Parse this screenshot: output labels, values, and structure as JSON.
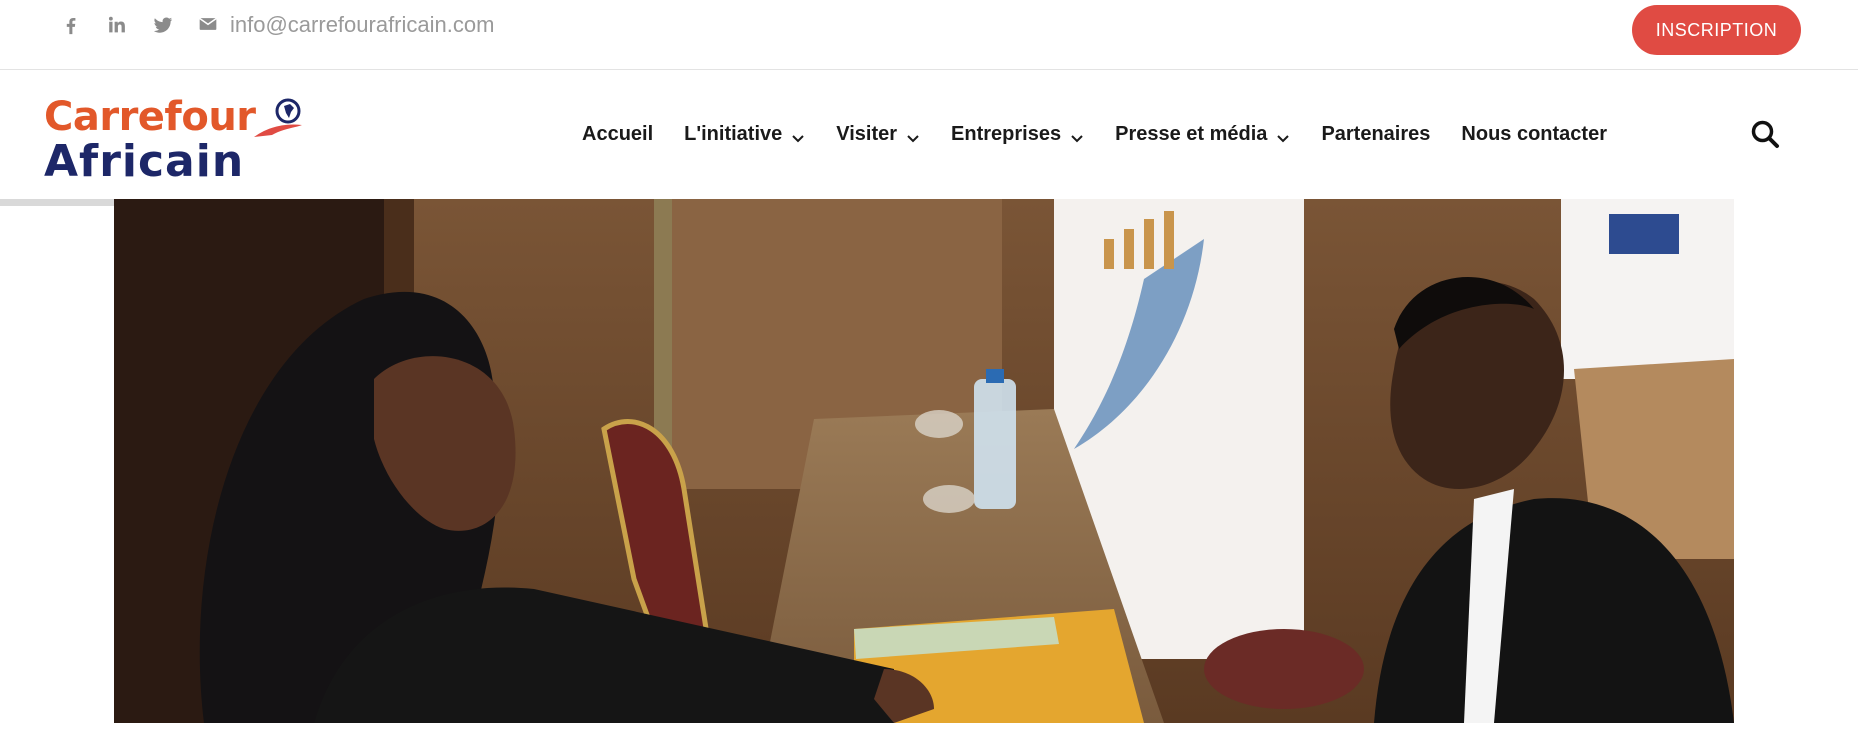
{
  "topbar": {
    "social": [
      {
        "icon": "facebook-icon"
      },
      {
        "icon": "linkedin-icon"
      },
      {
        "icon": "twitter-icon"
      }
    ],
    "email_icon": "envelope-icon",
    "email": "info@carrefourafricain.com",
    "inscription_label": "INSCRIPTION"
  },
  "header": {
    "logo": {
      "line1": "Carrefour",
      "line2": "Africain"
    },
    "nav": [
      {
        "label": "Accueil",
        "dropdown": false
      },
      {
        "label": "L'initiative",
        "dropdown": true
      },
      {
        "label": "Visiter",
        "dropdown": true
      },
      {
        "label": "Entreprises",
        "dropdown": true
      },
      {
        "label": "Presse et média",
        "dropdown": true
      },
      {
        "label": "Partenaires",
        "dropdown": false
      },
      {
        "label": "Nous contacter",
        "dropdown": false
      }
    ],
    "search_icon": "search-icon"
  },
  "hero": {
    "image": "Two people talking across a table at a business meeting"
  },
  "colors": {
    "accent": "#e04b43",
    "logo_orange": "#e2582a",
    "logo_navy": "#1d2768"
  }
}
